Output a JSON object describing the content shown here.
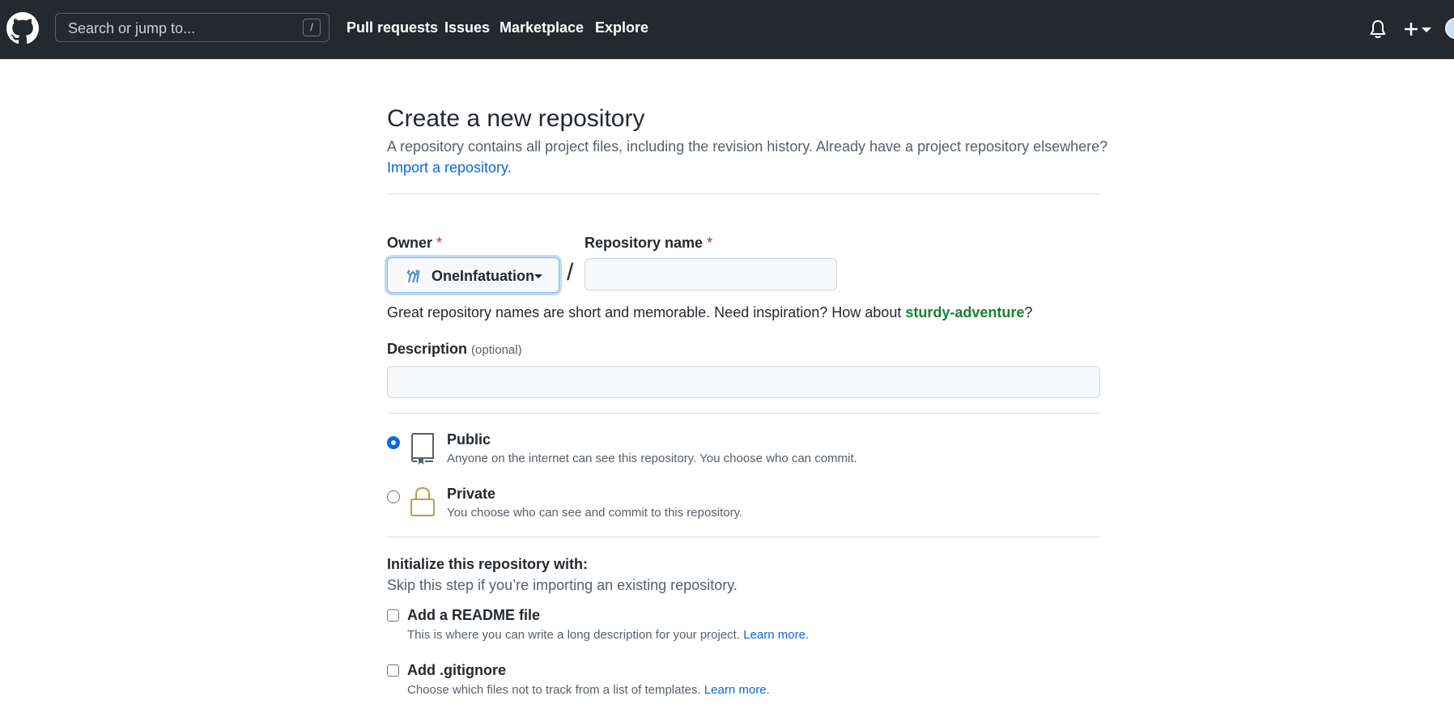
{
  "header": {
    "search_placeholder": "Search or jump to...",
    "search_shortcut": "/",
    "nav": [
      "Pull requests",
      "Issues",
      "Marketplace",
      "Explore"
    ]
  },
  "page": {
    "title": "Create a new repository",
    "description": "A repository contains all project files, including the revision history. Already have a project repository elsewhere?",
    "import_link": "Import a repository."
  },
  "form": {
    "owner_label": "Owner",
    "repo_label": "Repository name",
    "required_mark": "*",
    "owner_value": "OneInfatuation",
    "separator": "/",
    "repo_value": "",
    "hint_prefix": "Great repository names are short and memorable. Need inspiration? How about ",
    "hint_suggestion": "sturdy-adventure",
    "hint_suffix": "?",
    "description_label": "Description",
    "description_optional": "(optional)",
    "description_value": ""
  },
  "visibility": {
    "public_title": "Public",
    "public_desc": "Anyone on the internet can see this repository. You choose who can commit.",
    "private_title": "Private",
    "private_desc": "You choose who can see and commit to this repository.",
    "selected": "public"
  },
  "init": {
    "title": "Initialize this repository with:",
    "subtitle": "Skip this step if you’re importing an existing repository.",
    "readme_label": "Add a README file",
    "readme_desc": "This is where you can write a long description for your project.",
    "readme_link": "Learn more.",
    "gitignore_label": "Add .gitignore",
    "gitignore_desc": "Choose which files not to track from a list of templates.",
    "gitignore_link": "Learn more."
  },
  "colors": {
    "header_bg": "#24292f",
    "link": "#0969da",
    "suggestion": "#1a7f37",
    "required": "#cf222e"
  }
}
